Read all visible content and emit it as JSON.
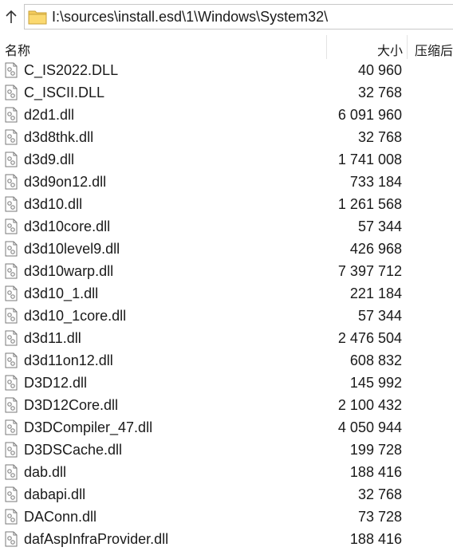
{
  "toolbar": {
    "up_icon": "arrow-up-icon"
  },
  "address_bar": {
    "path": "I:\\sources\\install.esd\\1\\Windows\\System32\\",
    "icon": "folder-icon"
  },
  "columns": {
    "name": "名称",
    "size": "大小",
    "compressed": "压缩后"
  },
  "files": [
    {
      "name": "C_IS2022.DLL",
      "size": "40 960"
    },
    {
      "name": "C_ISCII.DLL",
      "size": "32 768"
    },
    {
      "name": "d2d1.dll",
      "size": "6 091 960"
    },
    {
      "name": "d3d8thk.dll",
      "size": "32 768"
    },
    {
      "name": "d3d9.dll",
      "size": "1 741 008"
    },
    {
      "name": "d3d9on12.dll",
      "size": "733 184"
    },
    {
      "name": "d3d10.dll",
      "size": "1 261 568"
    },
    {
      "name": "d3d10core.dll",
      "size": "57 344"
    },
    {
      "name": "d3d10level9.dll",
      "size": "426 968"
    },
    {
      "name": "d3d10warp.dll",
      "size": "7 397 712"
    },
    {
      "name": "d3d10_1.dll",
      "size": "221 184"
    },
    {
      "name": "d3d10_1core.dll",
      "size": "57 344"
    },
    {
      "name": "d3d11.dll",
      "size": "2 476 504"
    },
    {
      "name": "d3d11on12.dll",
      "size": "608 832"
    },
    {
      "name": "D3D12.dll",
      "size": "145 992"
    },
    {
      "name": "D3D12Core.dll",
      "size": "2 100 432"
    },
    {
      "name": "D3DCompiler_47.dll",
      "size": "4 050 944"
    },
    {
      "name": "D3DSCache.dll",
      "size": "199 728"
    },
    {
      "name": "dab.dll",
      "size": "188 416"
    },
    {
      "name": "dabapi.dll",
      "size": "32 768"
    },
    {
      "name": "DAConn.dll",
      "size": "73 728"
    },
    {
      "name": "dafAspInfraProvider.dll",
      "size": "188 416"
    }
  ]
}
